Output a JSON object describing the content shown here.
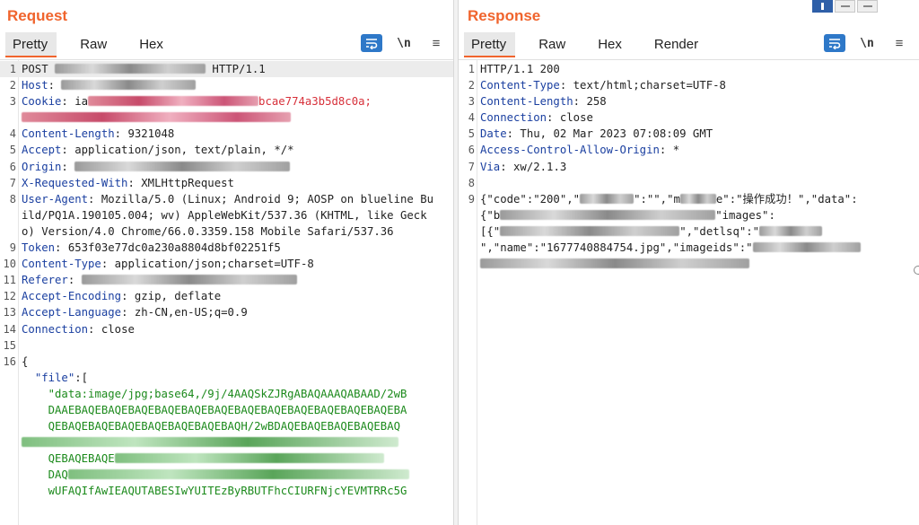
{
  "request": {
    "title": "Request",
    "tabs": [
      "Pretty",
      "Raw",
      "Hex"
    ],
    "newline_label": "\\n",
    "menu_label": "≡",
    "lines": [
      {
        "n": "1",
        "parts": [
          [
            "val",
            "POST "
          ],
          [
            "blur-g",
            "168"
          ],
          [
            "val",
            " HTTP/1.1"
          ]
        ]
      },
      {
        "n": "2",
        "parts": [
          [
            "key",
            "Host"
          ],
          [
            "val",
            ": "
          ],
          [
            "blur-g",
            "150"
          ]
        ]
      },
      {
        "n": "3",
        "parts": [
          [
            "key",
            "Cookie"
          ],
          [
            "val",
            ": ia"
          ],
          [
            "blur-r",
            "190"
          ],
          [
            "redx",
            "bcae774a3b5d8c0a;"
          ],
          [
            "br",
            ""
          ],
          [
            "blur-r",
            "300"
          ]
        ]
      },
      {
        "n": "4",
        "parts": [
          [
            "key",
            "Content-Length"
          ],
          [
            "val",
            ": 9321048"
          ]
        ]
      },
      {
        "n": "5",
        "parts": [
          [
            "key",
            "Accept"
          ],
          [
            "val",
            ": application/json, text/plain, */*"
          ]
        ]
      },
      {
        "n": "6",
        "parts": [
          [
            "key",
            "Origin"
          ],
          [
            "val",
            ": "
          ],
          [
            "blur-g",
            "240"
          ]
        ]
      },
      {
        "n": "7",
        "parts": [
          [
            "key",
            "X-Requested-With"
          ],
          [
            "val",
            ": XMLHttpRequest"
          ]
        ]
      },
      {
        "n": "8",
        "parts": [
          [
            "key",
            "User-Agent"
          ],
          [
            "val",
            ": Mozilla/5.0 (Linux; Android 9; AOSP on blueline Build/PQ1A.190105.004; wv) AppleWebKit/537.36 (KHTML, like Gecko) Version/4.0 Chrome/66.0.3359.158 Mobile Safari/537.36"
          ]
        ]
      },
      {
        "n": "9",
        "parts": [
          [
            "key",
            "Token"
          ],
          [
            "val",
            ": 653f03e77dc0a230a8804d8bf02251f5"
          ]
        ]
      },
      {
        "n": "10",
        "parts": [
          [
            "key",
            "Content-Type"
          ],
          [
            "val",
            ": application/json;charset=UTF-8"
          ]
        ]
      },
      {
        "n": "11",
        "parts": [
          [
            "key",
            "Referer"
          ],
          [
            "val",
            ": "
          ],
          [
            "blur-g",
            "240"
          ]
        ]
      },
      {
        "n": "12",
        "parts": [
          [
            "key",
            "Accept-Encoding"
          ],
          [
            "val",
            ": gzip, deflate"
          ]
        ]
      },
      {
        "n": "13",
        "parts": [
          [
            "key",
            "Accept-Language"
          ],
          [
            "val",
            ": zh-CN,en-US;q=0.9"
          ]
        ]
      },
      {
        "n": "14",
        "parts": [
          [
            "key",
            "Connection"
          ],
          [
            "val",
            ": close"
          ]
        ]
      },
      {
        "n": "15",
        "parts": []
      },
      {
        "n": "16",
        "parts": [
          [
            "val",
            "{"
          ]
        ]
      },
      {
        "n": "",
        "parts": [
          [
            "key",
            "  \"file\""
          ],
          [
            "val",
            ":["
          ]
        ]
      },
      {
        "n": "",
        "parts": [
          [
            "green",
            "    \"data:image/jpg;base64,/9j/4AAQSkZJRgABAQAAAQABAAD/2wB"
          ]
        ]
      },
      {
        "n": "",
        "parts": [
          [
            "green",
            "    DAAEBAQEBAQEBAQEBAQEBAQEBAQEBAQEBAQEBAQEBAQEBAQEBAQEBA"
          ]
        ]
      },
      {
        "n": "",
        "parts": [
          [
            "green",
            "    QEBAQEBAQEBAQEBAQEBAQEBAQEBAQH/2wBDAQEBAQEBAQEBAQEBAQ"
          ]
        ]
      },
      {
        "n": "",
        "parts": [
          [
            "blur-gr",
            "420"
          ]
        ]
      },
      {
        "n": "",
        "parts": [
          [
            "green",
            "    QEBAQEBAQE"
          ],
          [
            "blur-gr",
            "300"
          ]
        ]
      },
      {
        "n": "",
        "parts": [
          [
            "green",
            "    DAQ"
          ],
          [
            "blur-gr",
            "380"
          ]
        ]
      },
      {
        "n": "",
        "parts": [
          [
            "green",
            "    wUFAQIfAwIEAQUTABESIwYUITEzByRBUTFhcCIURFNjcYEVMTRRc5G"
          ]
        ]
      }
    ]
  },
  "response": {
    "title": "Response",
    "tabs": [
      "Pretty",
      "Raw",
      "Hex",
      "Render"
    ],
    "newline_label": "\\n",
    "menu_label": "≡",
    "lines": [
      {
        "n": "1",
        "parts": [
          [
            "val",
            "HTTP/1.1 200"
          ]
        ]
      },
      {
        "n": "2",
        "parts": [
          [
            "key",
            "Content-Type"
          ],
          [
            "val",
            ": text/html;charset=UTF-8"
          ]
        ]
      },
      {
        "n": "3",
        "parts": [
          [
            "key",
            "Content-Length"
          ],
          [
            "val",
            ": 258"
          ]
        ]
      },
      {
        "n": "4",
        "parts": [
          [
            "key",
            "Connection"
          ],
          [
            "val",
            ": close"
          ]
        ]
      },
      {
        "n": "5",
        "parts": [
          [
            "key",
            "Date"
          ],
          [
            "val",
            ": Thu, 02 Mar 2023 07:08:09 GMT"
          ]
        ]
      },
      {
        "n": "6",
        "parts": [
          [
            "key",
            "Access-Control-Allow-Origin"
          ],
          [
            "val",
            ": *"
          ]
        ]
      },
      {
        "n": "7",
        "parts": [
          [
            "key",
            "Via"
          ],
          [
            "val",
            ": xw/2.1.3"
          ]
        ]
      },
      {
        "n": "8",
        "parts": []
      },
      {
        "n": "9",
        "parts": [
          [
            "val",
            "{\"code\":\"200\",\""
          ],
          [
            "blur-g",
            "60"
          ],
          [
            "val",
            "\":\"\",\"m"
          ],
          [
            "blur-g",
            "40"
          ],
          [
            "val",
            "e\":\"操作成功！\",\"data\":"
          ],
          [
            "br",
            ""
          ],
          [
            "val",
            "{\"b"
          ],
          [
            "blur-g",
            "240"
          ],
          [
            "val",
            "\"images\":"
          ],
          [
            "br",
            ""
          ],
          [
            "val",
            "[{\""
          ],
          [
            "blur-g",
            "200"
          ],
          [
            "val",
            "\",\"detlsq\":\""
          ],
          [
            "blur-g",
            "70"
          ],
          [
            "br",
            ""
          ],
          [
            "val",
            "\",\"name\":\"1677740884754.jpg\",\"imageids\":\""
          ],
          [
            "blur-g",
            "120"
          ],
          [
            "br",
            ""
          ],
          [
            "blur-g",
            "300"
          ]
        ]
      }
    ]
  }
}
